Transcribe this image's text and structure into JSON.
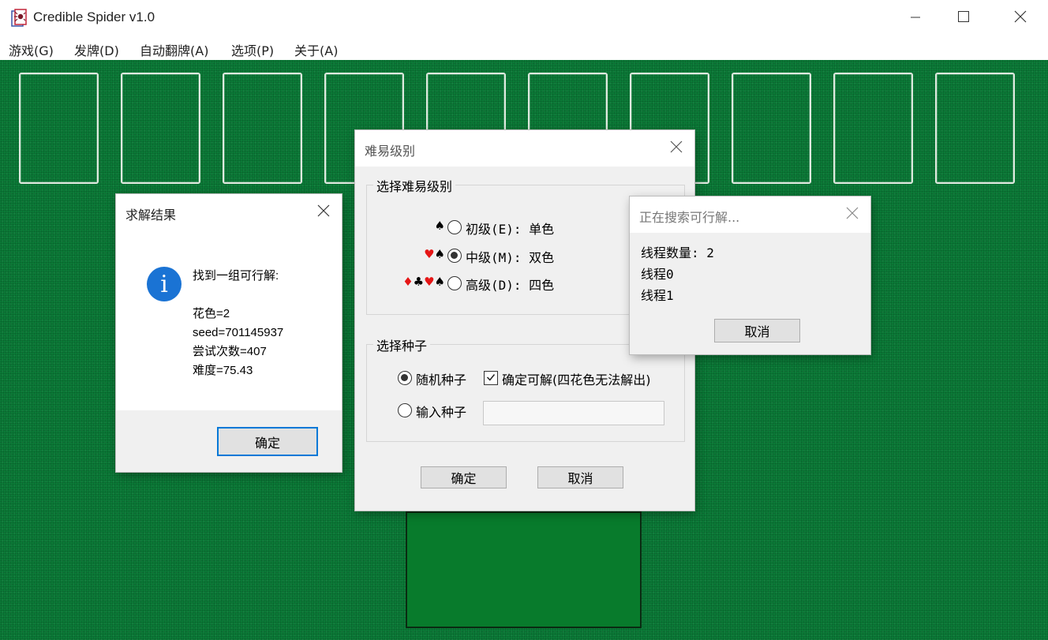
{
  "window": {
    "title": "Credible Spider v1.0",
    "icon": "spider-app-icon",
    "controls": {
      "minimize": "minimize-icon",
      "maximize": "maximize-icon",
      "close": "close-icon"
    }
  },
  "menu": [
    "游戏(G)",
    "发牌(D)",
    "自动翻牌(A)",
    "选项(P)",
    "关于(A)"
  ],
  "colors": {
    "felt": "#0b7a37",
    "accent": "#0078d7",
    "red_suit": "#e51616"
  },
  "result_dialog": {
    "title": "求解结果",
    "icon": "info-icon",
    "icon_glyph": "i",
    "lines": [
      "找到一组可行解:",
      "",
      "花色=2",
      "seed=701145937",
      "尝试次数=407",
      "难度=75.43"
    ],
    "ok_label": "确定"
  },
  "difficulty_dialog": {
    "title": "难易级别",
    "level_group_label": "选择难易级别",
    "levels": [
      {
        "suits_red": "",
        "suits": "♠",
        "label": "初级(E): 单色",
        "checked": false
      },
      {
        "suits_red": "♥",
        "suits": "♠",
        "label": "中级(M): 双色",
        "checked": true
      },
      {
        "suits_red": "",
        "suits": "♠",
        "label": "高级(D): 四色",
        "checked": false
      }
    ],
    "seed_group_label": "选择种子",
    "random_seed_label": "随机种子",
    "random_seed_checked": true,
    "ensure_solvable_label": "确定可解(四花色无法解出)",
    "ensure_solvable_checked": true,
    "input_seed_label": "输入种子",
    "input_seed_checked": false,
    "seed_value": "",
    "ok_label": "确定",
    "cancel_label": "取消"
  },
  "search_dialog": {
    "title": "正在搜索可行解...",
    "lines": [
      "线程数量: 2",
      "线程0",
      "线程1"
    ],
    "cancel_label": "取消"
  }
}
